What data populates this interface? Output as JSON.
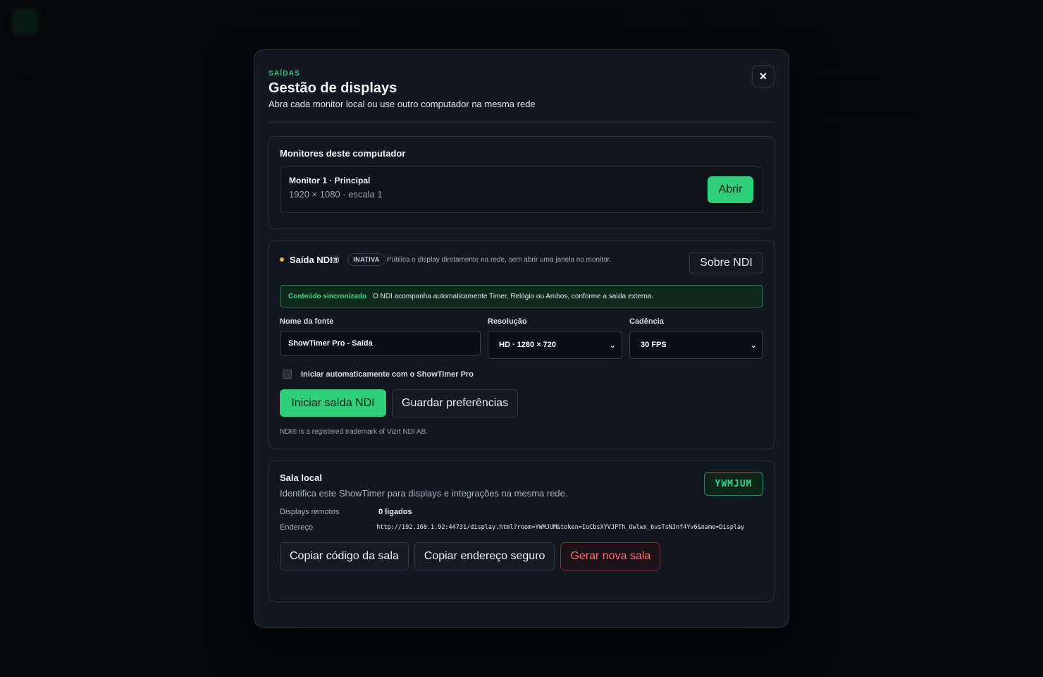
{
  "modal": {
    "eyebrow": "SAÍDAS",
    "title": "Gestão de displays",
    "subtitle": "Abra cada monitor local ou use outro computador na mesma rede",
    "close_label": "✕"
  },
  "monitors": {
    "title": "Monitores deste computador",
    "items": [
      {
        "name": "Monitor 1 · Principal",
        "meta": "1920 × 1080 · escala 1",
        "button": "Abrir"
      }
    ]
  },
  "ndi": {
    "title": "Saída NDI®",
    "status_badge": "INATIVA",
    "status_color": "#f3a93c",
    "description": "Publica o display diretamente na rede, sem abrir uma janela no monitor.",
    "about_button": "Sobre NDI",
    "sync_label": "Conteúdo sincronizado",
    "sync_text": "O NDI acompanha automaticamente Timer, Relógio ou Ambos, conforme a saída externa.",
    "source_name_label": "Nome da fonte",
    "source_name_value": "ShowTimer Pro - Saída",
    "resolution_label": "Resolução",
    "resolution_value": "HD · 1280 × 720",
    "cadence_label": "Cadência",
    "cadence_value": "30 FPS",
    "autostart_label": "Iniciar automaticamente com o ShowTimer Pro",
    "autostart_checked": false,
    "start_button": "Iniciar saída NDI",
    "save_button": "Guardar preferências",
    "trademark": "NDI® is a registered trademark of Vizrt NDI AB."
  },
  "sala": {
    "title": "Sala local",
    "subtitle": "Identifica este ShowTimer para displays e integrações na mesma rede.",
    "room_code": "YWMJUM",
    "remote_label": "Displays remotos",
    "remote_value": "0 ligados",
    "address_label": "Endereço",
    "address_value": "http://192.168.1.92:44731/display.html?room=YWMJUM&token=IoCbsXYVJPTh_Owlwx_6vsTsNJnf4Yv6&name=Display",
    "copy_code_button": "Copiar código da sala",
    "copy_address_button": "Copiar endereço seguro",
    "new_room_button": "Gerar nova sala"
  },
  "colors": {
    "accent": "#2fcf7a",
    "danger": "#ff6b76",
    "warning": "#f3a93c"
  }
}
